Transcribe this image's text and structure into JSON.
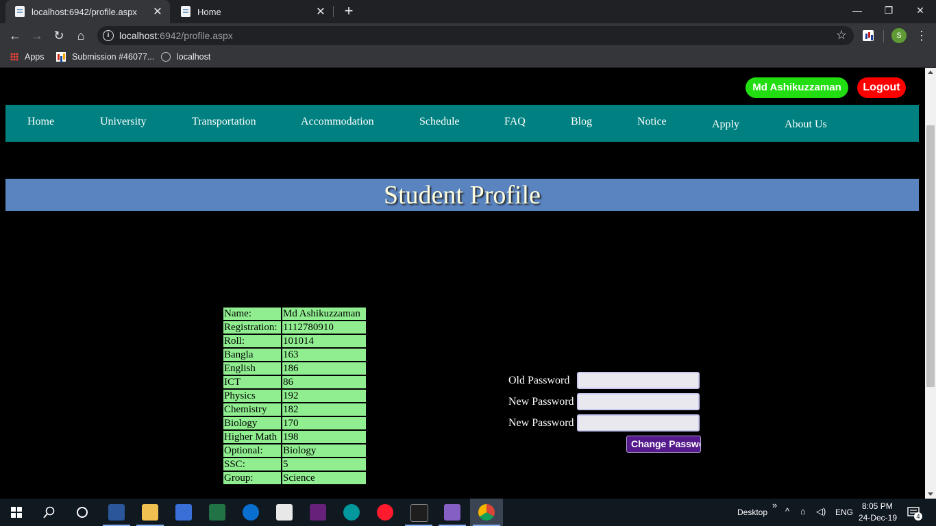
{
  "browser": {
    "tabs": [
      {
        "title": "localhost:6942/profile.aspx",
        "active": true
      },
      {
        "title": "Home",
        "active": false
      }
    ],
    "new_tab": "+",
    "window_controls": {
      "minimize": "—",
      "restore": "❐",
      "close": "✕"
    },
    "nav": {
      "back": "←",
      "forward": "→",
      "reload": "↻",
      "home": "⌂"
    },
    "url_host": "localhost",
    "url_rest": ":6942/profile.aspx",
    "info_glyph": "i",
    "star_glyph": "☆",
    "profile_initial": "S",
    "menu_glyph": "⋮",
    "bookmarks": [
      {
        "label": "Apps",
        "icon": "apps-grid-icon"
      },
      {
        "label": "Submission #46077...",
        "icon": "codeforces-icon"
      },
      {
        "label": "localhost",
        "icon": "globe-icon"
      }
    ]
  },
  "page": {
    "user_name": "Md Ashikuzzaman",
    "logout_label": "Logout",
    "nav_items": [
      "Home",
      "University",
      "Transportation",
      "Accommodation",
      "Schedule",
      "FAQ",
      "Blog",
      "Notice",
      "Apply",
      "About Us"
    ],
    "title": "Student Profile",
    "profile_rows": [
      {
        "key": "Name:",
        "value": "Md Ashikuzzaman"
      },
      {
        "key": "Registration:",
        "value": "1112780910"
      },
      {
        "key": "Roll:",
        "value": "101014"
      },
      {
        "key": "Bangla",
        "value": "163"
      },
      {
        "key": "English",
        "value": "186"
      },
      {
        "key": "ICT",
        "value": "86"
      },
      {
        "key": "Physics",
        "value": "192"
      },
      {
        "key": "Chemistry",
        "value": "182"
      },
      {
        "key": "Biology",
        "value": "170"
      },
      {
        "key": "Higher Math",
        "value": "198"
      },
      {
        "key": "Optional:",
        "value": "Biology"
      },
      {
        "key": "SSC:",
        "value": "5"
      },
      {
        "key": "Group:",
        "value": "Science"
      }
    ],
    "password_form": {
      "old_label": "Old Password",
      "new_label": "New Password",
      "confirm_label": "New Password",
      "old_value": "",
      "new_value": "",
      "confirm_value": "",
      "submit_label": "Change Password"
    },
    "colors": {
      "navbar": "#008080",
      "banner": "#5a84c0",
      "table_cell": "#90ee90",
      "user_button": "#22dd11",
      "logout_button": "#ff0000",
      "change_button": "#551a8b"
    }
  },
  "taskbar": {
    "desktop_label": "Desktop",
    "chevron": "»",
    "language": "ENG",
    "time": "8:05 PM",
    "date": "24-Dec-19",
    "notification_count": "4"
  }
}
